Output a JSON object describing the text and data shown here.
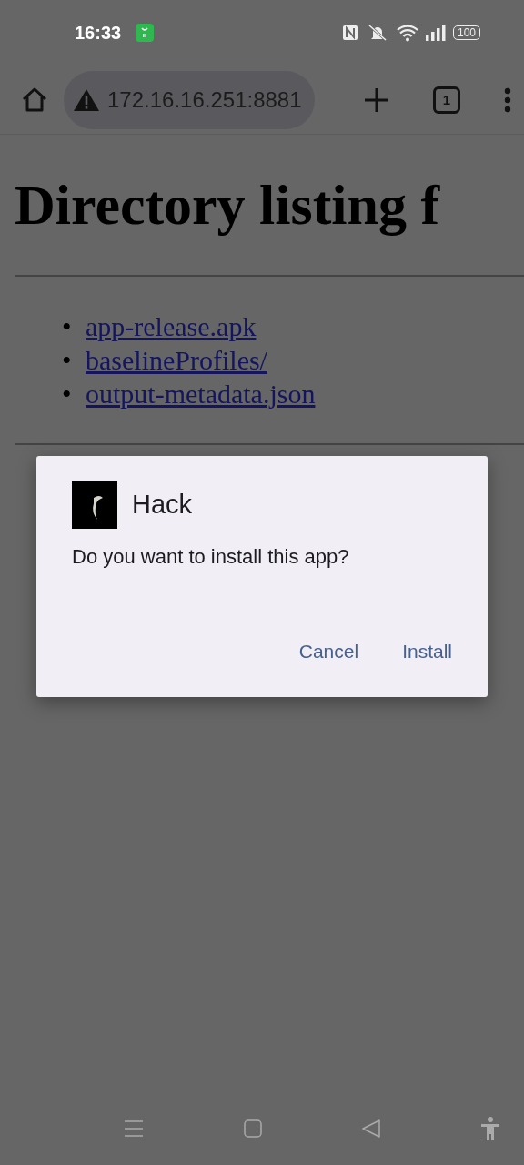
{
  "status_bar": {
    "time": "16:33",
    "battery": "100"
  },
  "browser_toolbar": {
    "url": "172.16.16.251:8881",
    "tab_count": "1"
  },
  "page": {
    "heading": "Directory listing f",
    "links": [
      {
        "bullet": "•",
        "name": "app-release.apk"
      },
      {
        "bullet": "•",
        "name": "baselineProfiles/"
      },
      {
        "bullet": "•",
        "name": "output-metadata.json"
      }
    ]
  },
  "dialog": {
    "app_name": "Hack",
    "message": "Do you want to install this app?",
    "buttons": [
      "Cancel",
      "Install"
    ]
  }
}
